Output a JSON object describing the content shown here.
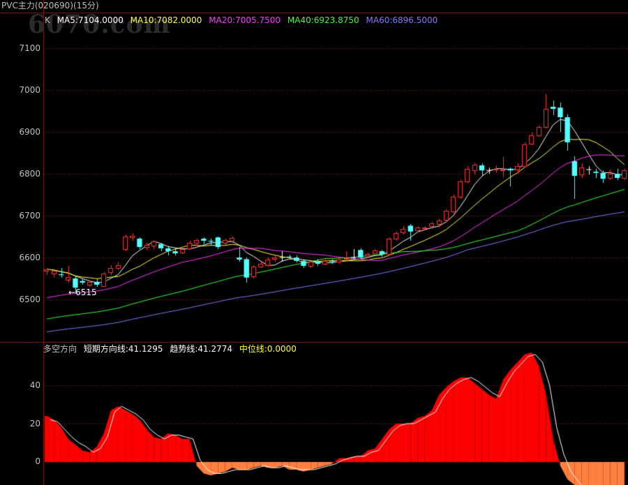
{
  "window_title": "PVC主力(020690)(15分)",
  "watermark": "6070.com",
  "colors": {
    "grid": "#8b1a1a",
    "axis_text": "#c0c0c0",
    "up": "#ff3232",
    "down": "#54ffff",
    "ma5": "#ffffff",
    "ma10": "#ffff33",
    "ma20": "#ff33ff",
    "ma40": "#33ff33",
    "ma60": "#7b7bff",
    "ind_positive": "#ff0000",
    "ind_negative": "#ff7f3f",
    "ind_line": "#ffffff"
  },
  "price_panel": {
    "label": "K",
    "legend": [
      {
        "text": "MA5:7104.0000",
        "color": "#ffffff"
      },
      {
        "text": "MA10:7082.0000",
        "color": "#ffff33"
      },
      {
        "text": "MA20:7005.7500",
        "color": "#ff33ff"
      },
      {
        "text": "MA40:6923.8750",
        "color": "#33ff33"
      },
      {
        "text": "MA60:6896.5000",
        "color": "#7b7bff"
      }
    ],
    "y_ticks": [
      "7100",
      "7000",
      "6900",
      "6800",
      "6700",
      "6600",
      "6500"
    ],
    "low_marker": "6515"
  },
  "indicator_panel": {
    "name": "多空方向",
    "legend": [
      {
        "text": "短期方向线:41.1295",
        "color": "#ffffff"
      },
      {
        "text": "趋势线:41.2774",
        "color": "#ffffff"
      },
      {
        "text": "中位线:0.0000",
        "color": "#ffff33"
      }
    ],
    "y_ticks": [
      "40",
      "20",
      "0"
    ]
  },
  "chart_data": [
    {
      "type": "candlestick",
      "ylim": [
        6488,
        7180
      ],
      "candles": [
        [
          6568,
          6572,
          6558,
          6575
        ],
        [
          6562,
          6568,
          6552,
          6570
        ],
        [
          6560,
          6558,
          6552,
          6575
        ],
        [
          6548,
          6554,
          6540,
          6580
        ],
        [
          6550,
          6528,
          6515,
          6555
        ],
        [
          6544,
          6540,
          6535,
          6550
        ],
        [
          6535,
          6541,
          6530,
          6545
        ],
        [
          6542,
          6535,
          6530,
          6550
        ],
        [
          6532,
          6562,
          6530,
          6565
        ],
        [
          6565,
          6575,
          6558,
          6582
        ],
        [
          6575,
          6582,
          6570,
          6590
        ],
        [
          6620,
          6650,
          6615,
          6655
        ],
        [
          6648,
          6652,
          6640,
          6658
        ],
        [
          6645,
          6625,
          6620,
          6648
        ],
        [
          6625,
          6630,
          6618,
          6635
        ],
        [
          6628,
          6638,
          6620,
          6640
        ],
        [
          6632,
          6622,
          6615,
          6635
        ],
        [
          6622,
          6615,
          6605,
          6628
        ],
        [
          6615,
          6610,
          6605,
          6622
        ],
        [
          6612,
          6620,
          6608,
          6625
        ],
        [
          6622,
          6635,
          6618,
          6640
        ],
        [
          6635,
          6642,
          6628,
          6645
        ],
        [
          6645,
          6640,
          6632,
          6648
        ],
        [
          6640,
          6638,
          6628,
          6645
        ],
        [
          6648,
          6625,
          6620,
          6650
        ],
        [
          6636,
          6642,
          6630,
          6645
        ],
        [
          6640,
          6646,
          6635,
          6650
        ],
        [
          6600,
          6595,
          6590,
          6625
        ],
        [
          6596,
          6552,
          6540,
          6600
        ],
        [
          6555,
          6578,
          6550,
          6582
        ],
        [
          6578,
          6585,
          6575,
          6590
        ],
        [
          6582,
          6595,
          6578,
          6600
        ],
        [
          6596,
          6600,
          6590,
          6605
        ],
        [
          6600,
          6600,
          6590,
          6615
        ],
        [
          6602,
          6600,
          6596,
          6606
        ],
        [
          6600,
          6592,
          6588,
          6605
        ],
        [
          6592,
          6580,
          6575,
          6596
        ],
        [
          6580,
          6590,
          6575,
          6594
        ],
        [
          6590,
          6585,
          6580,
          6596
        ],
        [
          6586,
          6592,
          6582,
          6596
        ],
        [
          6592,
          6590,
          6585,
          6596
        ],
        [
          6590,
          6595,
          6585,
          6600
        ],
        [
          6596,
          6598,
          6590,
          6615
        ],
        [
          6600,
          6600,
          6595,
          6620
        ],
        [
          6618,
          6600,
          6598,
          6622
        ],
        [
          6604,
          6608,
          6600,
          6612
        ],
        [
          6610,
          6616,
          6608,
          6620
        ],
        [
          6615,
          6608,
          6602,
          6618
        ],
        [
          6608,
          6645,
          6605,
          6648
        ],
        [
          6645,
          6658,
          6640,
          6662
        ],
        [
          6660,
          6668,
          6655,
          6675
        ],
        [
          6676,
          6662,
          6640,
          6680
        ],
        [
          6665,
          6672,
          6660,
          6675
        ],
        [
          6670,
          6672,
          6665,
          6675
        ],
        [
          6675,
          6682,
          6668,
          6685
        ],
        [
          6680,
          6688,
          6672,
          6692
        ],
        [
          6690,
          6712,
          6685,
          6715
        ],
        [
          6710,
          6745,
          6705,
          6750
        ],
        [
          6745,
          6782,
          6740,
          6785
        ],
        [
          6782,
          6812,
          6778,
          6818
        ],
        [
          6808,
          6822,
          6798,
          6826
        ],
        [
          6820,
          6808,
          6795,
          6825
        ],
        [
          6808,
          6808,
          6800,
          6815
        ],
        [
          6810,
          6812,
          6802,
          6820
        ],
        [
          6808,
          6810,
          6792,
          6840
        ],
        [
          6812,
          6808,
          6770,
          6815
        ],
        [
          6810,
          6818,
          6800,
          6825
        ],
        [
          6818,
          6870,
          6815,
          6875
        ],
        [
          6872,
          6892,
          6868,
          6898
        ],
        [
          6892,
          6912,
          6888,
          6915
        ],
        [
          6912,
          6955,
          6908,
          6990
        ],
        [
          6960,
          6955,
          6940,
          6975
        ],
        [
          6958,
          6935,
          6900,
          6970
        ],
        [
          6935,
          6875,
          6855,
          6942
        ],
        [
          6830,
          6795,
          6740,
          6842
        ],
        [
          6798,
          6815,
          6790,
          6825
        ],
        [
          6810,
          6810,
          6798,
          6818
        ],
        [
          6805,
          6802,
          6790,
          6812
        ],
        [
          6802,
          6788,
          6778,
          6808
        ],
        [
          6790,
          6800,
          6785,
          6810
        ],
        [
          6800,
          6790,
          6785,
          6812
        ],
        [
          6790,
          6808,
          6785,
          6812
        ]
      ]
    },
    {
      "type": "area",
      "ylim": [
        -55,
        62
      ],
      "short_line": [
        24,
        22,
        18,
        12,
        9,
        6,
        5,
        8,
        15,
        27,
        29,
        27,
        25,
        22,
        17,
        13,
        12,
        15,
        14,
        12,
        12,
        -2,
        -6,
        -7,
        -6,
        -5,
        -3,
        -4,
        -4,
        -3,
        -2,
        -3,
        -3,
        -2,
        -4,
        -4,
        -5,
        -4,
        -3,
        -2,
        -1,
        2,
        2,
        3,
        3,
        6,
        7,
        12,
        17,
        20,
        20,
        20,
        23,
        24,
        27,
        35,
        39,
        42,
        44,
        44,
        41,
        38,
        35,
        33,
        43,
        48,
        52,
        56,
        57,
        50,
        35,
        12,
        -2,
        -9,
        -12,
        -15,
        -18,
        -19,
        -20,
        -21,
        -22,
        -22
      ],
      "trend_line": [
        22,
        21,
        17,
        13,
        10,
        8,
        5,
        7,
        13,
        26,
        29,
        27,
        25,
        22,
        17,
        14,
        12,
        14,
        14,
        13,
        12,
        1,
        -4,
        -6,
        -6,
        -5,
        -4,
        -4,
        -4,
        -3,
        -2,
        -3,
        -3,
        -2,
        -3,
        -4,
        -4,
        -4,
        -3,
        -2,
        -1,
        1,
        2,
        3,
        3,
        5,
        6,
        11,
        16,
        19,
        20,
        20,
        22,
        24,
        26,
        33,
        38,
        41,
        43,
        44,
        42,
        39,
        36,
        34,
        41,
        47,
        51,
        55,
        56,
        52,
        40,
        18,
        4,
        -5,
        -10,
        -14,
        -17,
        -19,
        -20,
        -21,
        -22,
        -22
      ]
    }
  ]
}
